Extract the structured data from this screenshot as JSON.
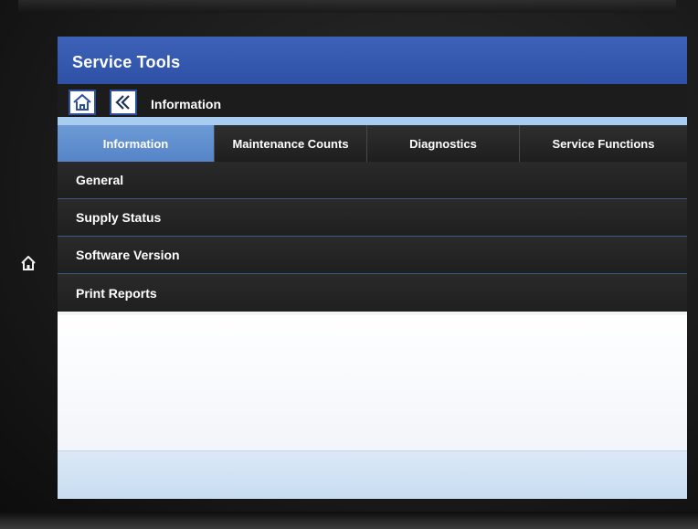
{
  "titlebar": {
    "title": "Service Tools"
  },
  "nav": {
    "home_icon": "home-icon",
    "back_icon": "back-icon",
    "breadcrumb": "Information"
  },
  "tabs": [
    {
      "label": "Information",
      "active": true
    },
    {
      "label": "Maintenance Counts",
      "active": false
    },
    {
      "label": "Diagnostics",
      "active": false
    },
    {
      "label": "Service Functions",
      "active": false
    }
  ],
  "list": {
    "items": [
      {
        "label": "General"
      },
      {
        "label": "Supply Status"
      },
      {
        "label": "Software Version"
      },
      {
        "label": "Print Reports"
      }
    ]
  },
  "device": {
    "hardware_home_icon": "home-icon"
  },
  "colors": {
    "titlebar": "#2e51a6",
    "active_tab": "#5f8fd0",
    "accent_strip": "#a9cdf0",
    "list_bg": "#222222",
    "footer": "#cfe1f3"
  }
}
